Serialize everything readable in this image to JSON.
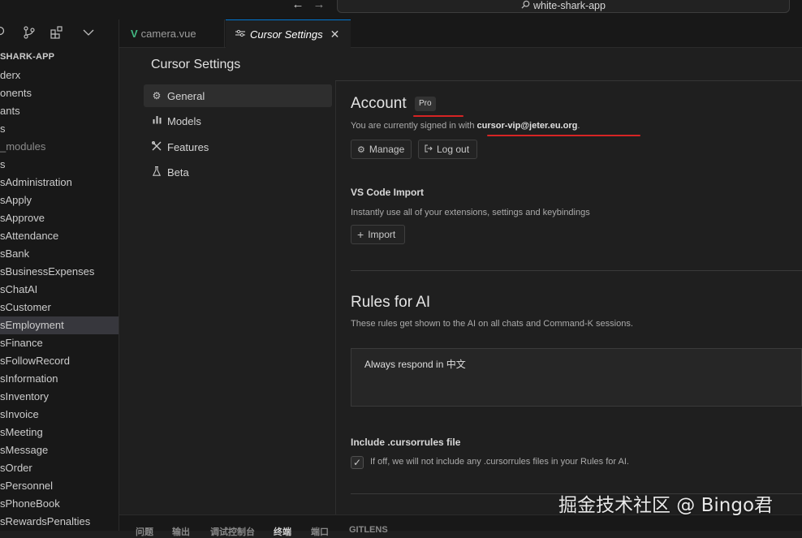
{
  "titlebar": {
    "search_text": "white-shark-app",
    "search_icon": "search-icon",
    "back_glyph": "←",
    "forward_glyph": "→"
  },
  "sidebar": {
    "project": "SHARK-APP",
    "items": [
      {
        "label": "derx",
        "muted": false,
        "selected": false
      },
      {
        "label": "onents",
        "muted": false,
        "selected": false
      },
      {
        "label": "ants",
        "muted": false,
        "selected": false
      },
      {
        "label": "s",
        "muted": false,
        "selected": false
      },
      {
        "label": "_modules",
        "muted": true,
        "selected": false
      },
      {
        "label": "s",
        "muted": false,
        "selected": false
      },
      {
        "label": "sAdministration",
        "muted": false,
        "selected": false
      },
      {
        "label": "sApply",
        "muted": false,
        "selected": false
      },
      {
        "label": "sApprove",
        "muted": false,
        "selected": false
      },
      {
        "label": "sAttendance",
        "muted": false,
        "selected": false
      },
      {
        "label": "sBank",
        "muted": false,
        "selected": false
      },
      {
        "label": "sBusinessExpenses",
        "muted": false,
        "selected": false
      },
      {
        "label": "sChatAI",
        "muted": false,
        "selected": false
      },
      {
        "label": "sCustomer",
        "muted": false,
        "selected": false
      },
      {
        "label": "sEmployment",
        "muted": false,
        "selected": true
      },
      {
        "label": "sFinance",
        "muted": false,
        "selected": false
      },
      {
        "label": "sFollowRecord",
        "muted": false,
        "selected": false
      },
      {
        "label": "sInformation",
        "muted": false,
        "selected": false
      },
      {
        "label": "sInventory",
        "muted": false,
        "selected": false
      },
      {
        "label": "sInvoice",
        "muted": false,
        "selected": false
      },
      {
        "label": "sMeeting",
        "muted": false,
        "selected": false
      },
      {
        "label": "sMessage",
        "muted": false,
        "selected": false
      },
      {
        "label": "sOrder",
        "muted": false,
        "selected": false
      },
      {
        "label": "sPersonnel",
        "muted": false,
        "selected": false
      },
      {
        "label": "sPhoneBook",
        "muted": false,
        "selected": false
      },
      {
        "label": "sRewardsPenalties",
        "muted": false,
        "selected": false
      }
    ]
  },
  "tabs": [
    {
      "label": "camera.vue",
      "icon": "vue-icon",
      "active": false
    },
    {
      "label": "Cursor Settings",
      "icon": "settings-icon",
      "active": true
    }
  ],
  "settings": {
    "title": "Cursor Settings",
    "nav": [
      {
        "label": "General",
        "icon": "gear-icon",
        "active": true
      },
      {
        "label": "Models",
        "icon": "bar-chart-icon",
        "active": false
      },
      {
        "label": "Features",
        "icon": "tools-icon",
        "active": false
      },
      {
        "label": "Beta",
        "icon": "flask-icon",
        "active": false
      }
    ],
    "account": {
      "heading": "Account",
      "badge": "Pro",
      "signed_in_prefix": "You are currently signed in with ",
      "email": "cursor-vip@jeter.eu.org",
      "signed_in_suffix": ".",
      "manage_label": "Manage",
      "logout_label": "Log out"
    },
    "vscode_import": {
      "heading": "VS Code Import",
      "description": "Instantly use all of your extensions, settings and keybindings",
      "button_label": "Import"
    },
    "rules": {
      "heading": "Rules for AI",
      "description": "These rules get shown to the AI on all chats and Command-K sessions.",
      "value": "Always respond in 中文"
    },
    "cursorrules": {
      "heading": "Include .cursorrules file",
      "description": "If off, we will not include any .cursorrules files in your Rules for AI.",
      "checked": true
    }
  },
  "panel_tabs": [
    "问题",
    "输出",
    "调试控制台",
    "终端",
    "端口",
    "GITLENS"
  ],
  "watermark": "掘金技术社区 @ Bingo君",
  "colors": {
    "accent": "#0078d4",
    "annotation_red": "#d62424",
    "vue_green": "#42b883"
  }
}
